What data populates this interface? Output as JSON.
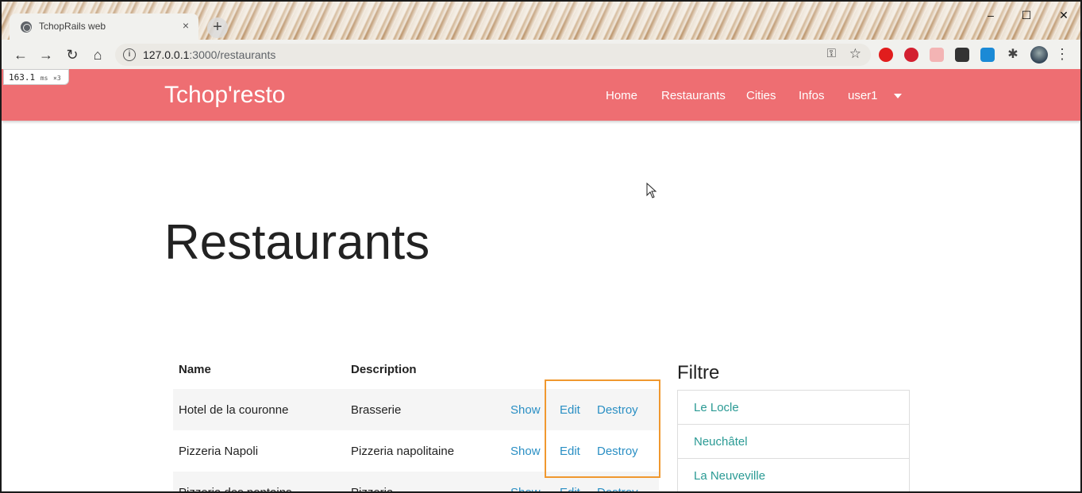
{
  "browser": {
    "tab_title": "TchopRails web",
    "tab_close": "×",
    "new_tab": "+",
    "url_host": "127.0.0.1",
    "url_path": ":3000/restaurants",
    "window_controls": [
      "–",
      "☐",
      "✕"
    ]
  },
  "timing": {
    "value": "163.1",
    "unit": "ms",
    "count": "×3"
  },
  "navbar": {
    "brand": "Tchop'resto",
    "links": [
      "Home",
      "Restaurants",
      "Cities",
      "Infos",
      "user1"
    ]
  },
  "page": {
    "title": "Restaurants",
    "table": {
      "headers": [
        "Name",
        "Description"
      ],
      "rows": [
        {
          "name": "Hotel de la couronne",
          "description": "Brasserie",
          "show": "Show",
          "edit": "Edit",
          "destroy": "Destroy"
        },
        {
          "name": "Pizzeria Napoli",
          "description": "Pizzeria napolitaine",
          "show": "Show",
          "edit": "Edit",
          "destroy": "Destroy"
        },
        {
          "name": "Pizzeria des pontains",
          "description": "Pizzeria",
          "show": "Show",
          "edit": "Edit",
          "destroy": "Destroy"
        }
      ]
    },
    "filter": {
      "title": "Filtre",
      "items": [
        "Le Locle",
        "Neuchâtel",
        "La Neuveville"
      ]
    }
  },
  "colors": {
    "navbar_bg": "#ee6e72",
    "link": "#2a8fc4",
    "filter_link": "#2a9a94",
    "highlight_border": "#f0982f"
  },
  "icons": [
    "globe-icon",
    "back-arrow-icon",
    "forward-arrow-icon",
    "reload-icon",
    "home-icon",
    "info-icon",
    "key-icon",
    "star-icon",
    "extensions-icon",
    "profile-avatar",
    "menu-kebab-icon",
    "dropdown-caret-icon"
  ]
}
